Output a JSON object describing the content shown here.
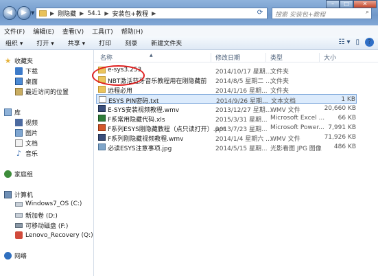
{
  "address": {
    "segments": [
      "刚隐藏",
      "54.1",
      "安装包+教程"
    ],
    "search_placeholder": "搜索 安装包+教程"
  },
  "menu": [
    "文件(F)",
    "编辑(E)",
    "查看(V)",
    "工具(T)",
    "帮助(H)"
  ],
  "toolbar": {
    "organize": "组织 ▾",
    "open": "打开 ▾",
    "share": "共享 ▾",
    "print": "打印",
    "burn": "刻录",
    "new_folder": "新建文件夹"
  },
  "nav": {
    "favorites": "收藏夹",
    "downloads": "下载",
    "desktop": "桌面",
    "recent": "最近访问的位置",
    "libraries": "库",
    "videos": "视频",
    "pictures": "图片",
    "documents": "文档",
    "music": "音乐",
    "homegroup": "家庭组",
    "computer": "计算机",
    "drive_c": "Windows7_OS (C:)",
    "drive_d": "新加卷 (D:)",
    "drive_f": "可移动磁盘 (F:)",
    "drive_q": "Lenovo_Recovery (Q:)",
    "network": "网络"
  },
  "columns": {
    "name": "名称",
    "date": "修改日期",
    "type": "类型",
    "size": "大小"
  },
  "files": [
    {
      "icon": "folder-icon",
      "name": "e-sys3.253",
      "date": "2014/10/17 星期...",
      "type": "文件夹",
      "size": ""
    },
    {
      "icon": "folder-icon",
      "name": "NBT激活蓝牙音乐教程用在刚隐藏前",
      "date": "2014/8/5 星期二 ...",
      "type": "文件夹",
      "size": ""
    },
    {
      "icon": "folder-icon",
      "name": "远程必用",
      "date": "2014/1/16 星期...",
      "type": "文件夹",
      "size": ""
    },
    {
      "icon": "text-file-icon",
      "name": "ESYS PIN密码.txt",
      "date": "2014/9/26 星期...",
      "type": "文本文档",
      "size": "1 KB"
    },
    {
      "icon": "video-file-icon",
      "name": "E-SYS安装视频教程.wmv",
      "date": "2013/12/27 星期...",
      "type": "WMV 文件",
      "size": "20,660 KB"
    },
    {
      "icon": "excel-file-icon",
      "name": "F系常用隐藏代码.xls",
      "date": "2015/3/31 星期...",
      "type": "Microsoft Excel ...",
      "size": "66 KB"
    },
    {
      "icon": "powerpoint-file-icon",
      "name": "F系列ESYS刚隐藏教程（点只读打开）.ppt",
      "date": "2013/7/23 星期...",
      "type": "Microsoft Power...",
      "size": "7,991 KB"
    },
    {
      "icon": "video-file-icon",
      "name": "F系列刚隐藏视频教程.wmv",
      "date": "2014/1/4 星期六 ...",
      "type": "WMV 文件",
      "size": "71,926 KB"
    },
    {
      "icon": "image-file-icon",
      "name": "必读ESYS注意事项.jpg",
      "date": "2014/5/15 星期...",
      "type": "光影看图 JPG 图像",
      "size": "486 KB"
    }
  ]
}
